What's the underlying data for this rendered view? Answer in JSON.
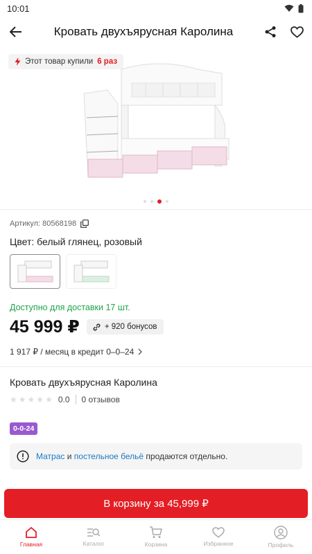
{
  "status_bar": {
    "time": "10:01"
  },
  "app_bar": {
    "title": "Кровать двухъярусная Каролина",
    "icons": [
      "back-arrow-icon",
      "share-icon",
      "heart-icon"
    ]
  },
  "gallery": {
    "promo_text": "Этот товар купили",
    "promo_count": "6 раз",
    "slides_count": 4,
    "active_slide": 3
  },
  "product": {
    "sku_label": "Артикул: 80568198",
    "color_line": "Цвет: белый глянец, розовый",
    "availability": "Доступно для доставки 17 шт.",
    "price": "45 999 ₽",
    "bonus": "+ 920 бонусов",
    "credit": "1 917 ₽ / месяц в кредит 0–0–24",
    "name": "Кровать двухъярусная Каролина",
    "rating": "0.0",
    "reviews": "0 отзывов",
    "tag": "0-0-24"
  },
  "notice": {
    "link1": "Матрас",
    "and": " и ",
    "link2": "постельное бельё",
    "rest": " продаются отдельно."
  },
  "cart_button": "В корзину за 45,999 ₽",
  "bottom_nav": [
    {
      "label": "Главная",
      "icon": "home-icon"
    },
    {
      "label": "Каталог",
      "icon": "catalog-icon"
    },
    {
      "label": "Корзина",
      "icon": "cart-icon"
    },
    {
      "label": "Избранное",
      "icon": "heart-icon"
    },
    {
      "label": "Профиль",
      "icon": "profile-icon"
    }
  ],
  "colors": {
    "accent": "#e31e24",
    "green": "#1fa34b",
    "link": "#1b79c5",
    "tag": "#9b59d0"
  }
}
